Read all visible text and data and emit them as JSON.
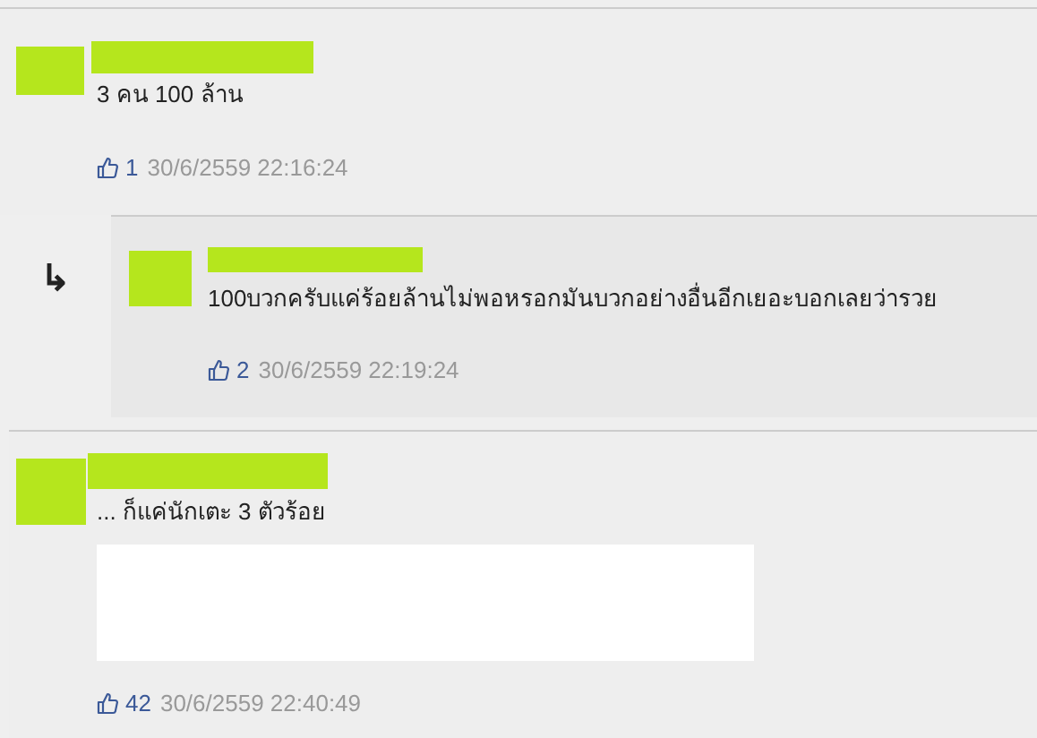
{
  "comments": [
    {
      "kind": "comment",
      "text": "3 คน 100 ล้าน",
      "likes": "1",
      "timestamp": "30/6/2559 22:16:24"
    },
    {
      "kind": "reply",
      "reply_arrow": "↳",
      "text": "100บวกครับแค่ร้อยล้านไม่พอหรอกมันบวกอย่างอื่นอีกเยอะบอกเลยว่ารวย",
      "likes": "2",
      "timestamp": "30/6/2559 22:19:24"
    },
    {
      "kind": "comment_hidden",
      "text": "... ก็แค่นักเตะ 3 ตัวร้อย",
      "likes": "42",
      "timestamp": "30/6/2559 22:40:49"
    }
  ]
}
